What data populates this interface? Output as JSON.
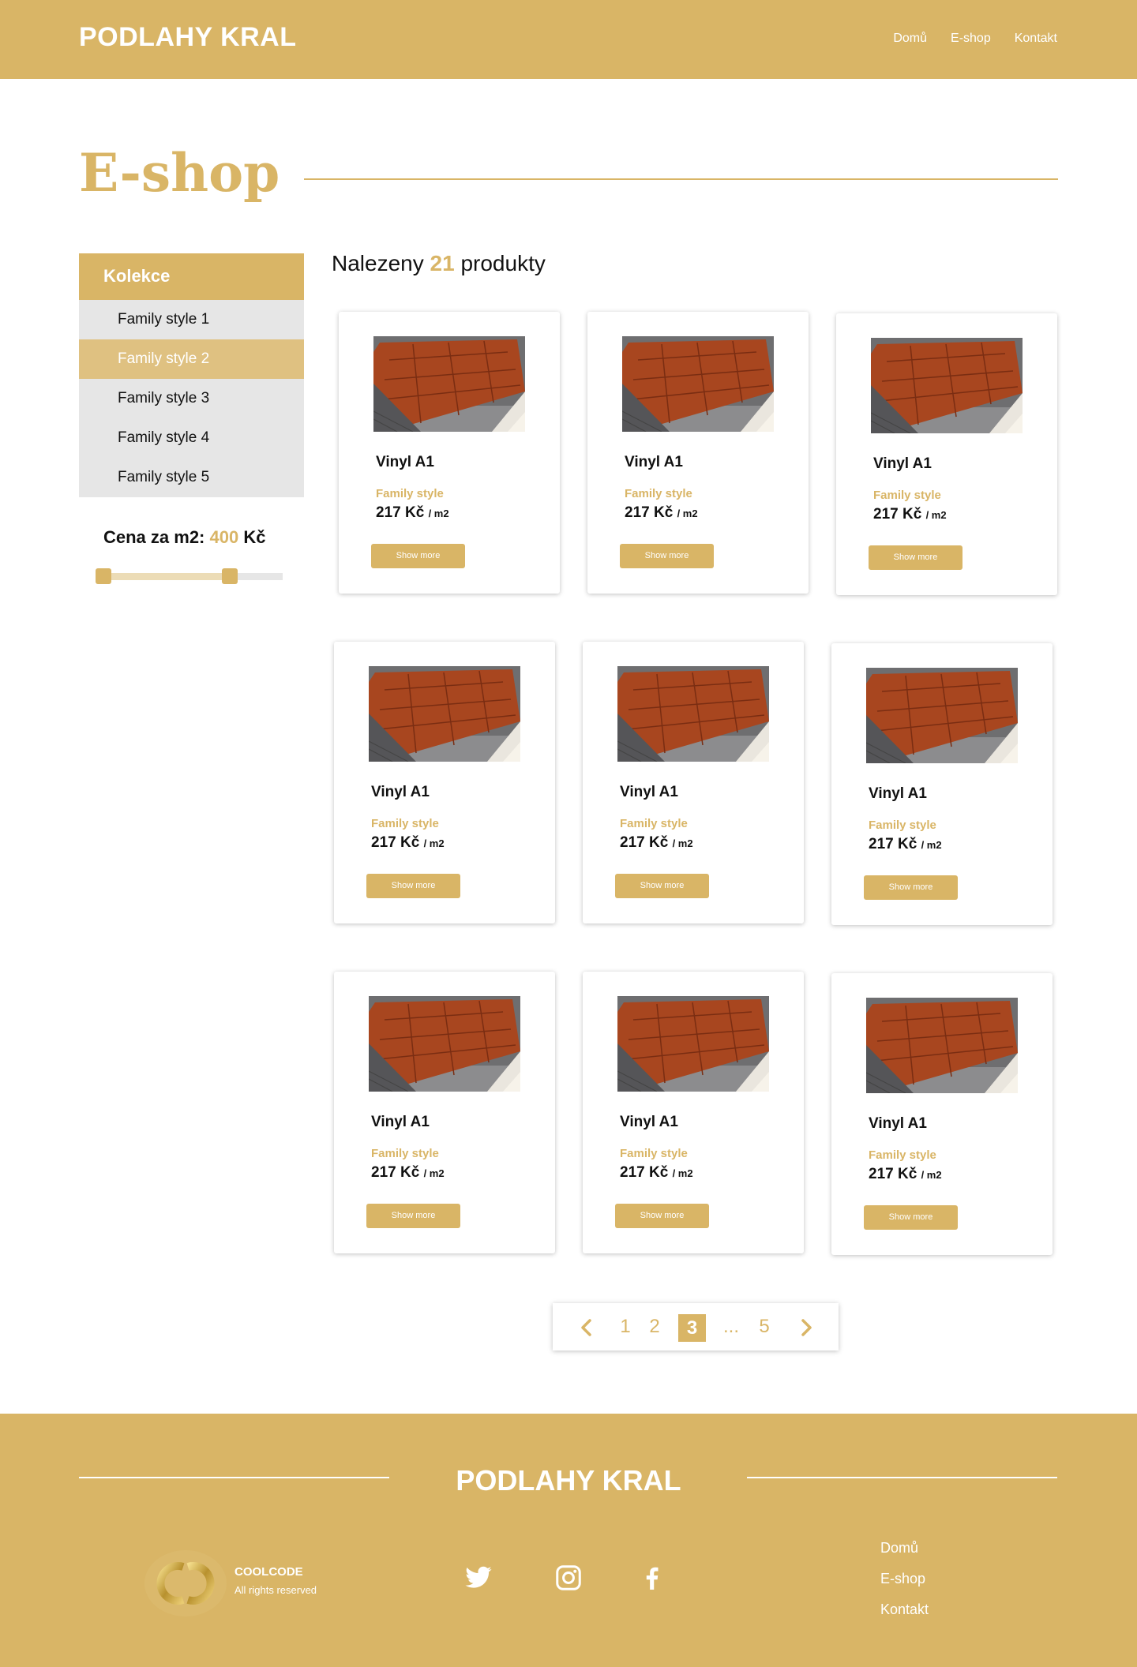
{
  "header": {
    "logo": "PODLAHY KRAL",
    "nav": [
      "Domů",
      "E-shop",
      "Kontakt"
    ]
  },
  "page_title": "E-shop",
  "sidebar": {
    "heading": "Kolekce",
    "items": [
      "Family style 1",
      "Family style 2",
      "Family style 3",
      "Family style 4",
      "Family style 5"
    ],
    "active_index": 1
  },
  "price_filter": {
    "label": "Cena za m2:",
    "value": "400",
    "currency": "Kč"
  },
  "results": {
    "prefix": "Nalezeny",
    "count": "21",
    "suffix": "produkty"
  },
  "products": [
    {
      "name": "Vinyl A1",
      "collection": "Family style",
      "price": "217 Kč",
      "unit": "/ m2",
      "button": "Show more"
    },
    {
      "name": "Vinyl A1",
      "collection": "Family style",
      "price": "217 Kč",
      "unit": "/ m2",
      "button": "Show more"
    },
    {
      "name": "Vinyl A1",
      "collection": "Family style",
      "price": "217 Kč",
      "unit": "/ m2",
      "button": "Show more"
    },
    {
      "name": "Vinyl A1",
      "collection": "Family style",
      "price": "217 Kč",
      "unit": "/ m2",
      "button": "Show more"
    },
    {
      "name": "Vinyl A1",
      "collection": "Family style",
      "price": "217 Kč",
      "unit": "/ m2",
      "button": "Show more"
    },
    {
      "name": "Vinyl A1",
      "collection": "Family style",
      "price": "217 Kč",
      "unit": "/ m2",
      "button": "Show more"
    },
    {
      "name": "Vinyl A1",
      "collection": "Family style",
      "price": "217 Kč",
      "unit": "/ m2",
      "button": "Show more"
    },
    {
      "name": "Vinyl A1",
      "collection": "Family style",
      "price": "217 Kč",
      "unit": "/ m2",
      "button": "Show more"
    },
    {
      "name": "Vinyl A1",
      "collection": "Family style",
      "price": "217 Kč",
      "unit": "/ m2",
      "button": "Show more"
    }
  ],
  "pagination": {
    "pages": [
      "1",
      "2",
      "3",
      "...",
      "5"
    ],
    "current": "3"
  },
  "footer": {
    "title": "PODLAHY KRAL",
    "brand": "COOLCODE",
    "rights": "All rights reserved",
    "social": [
      "twitter-icon",
      "instagram-icon",
      "facebook-icon"
    ],
    "nav": [
      "Domů",
      "E-shop",
      "Kontakt"
    ]
  },
  "colors": {
    "accent": "#d9b566",
    "accent_light": "#dfc181",
    "sidebar_bg": "#e6e6e6"
  }
}
